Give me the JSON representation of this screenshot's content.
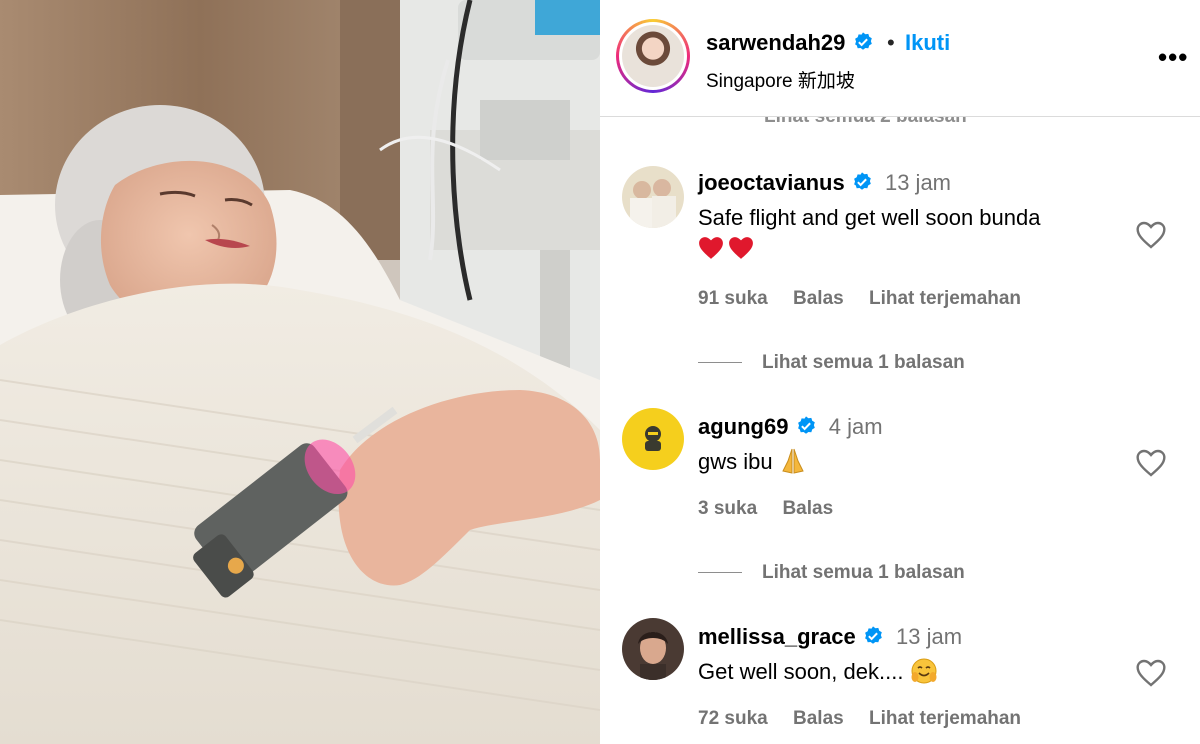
{
  "post": {
    "username": "sarwendah29",
    "follow_label": "Ikuti",
    "separator": "•",
    "location": "Singapore 新加坡",
    "more_label": "•••"
  },
  "comments_partial": {
    "view_replies_label": "Lihat semua 2 balasan"
  },
  "comments": [
    {
      "username": "joeoctavianus",
      "time": "13 jam",
      "text": "Safe flight and get well soon bunda",
      "likes": "91 suka",
      "reply_label": "Balas",
      "translate_label": "Lihat terjemahan",
      "view_replies_label": "Lihat semua 1 balasan"
    },
    {
      "username": "agung69",
      "time": "4 jam",
      "text": "gws ibu",
      "likes": "3 suka",
      "reply_label": "Balas",
      "view_replies_label": "Lihat semua 1 balasan"
    },
    {
      "username": "mellissa_grace",
      "time": "13 jam",
      "text": "Get well soon, dek....",
      "likes": "72 suka",
      "reply_label": "Balas",
      "translate_label": "Lihat terjemahan"
    }
  ],
  "colors": {
    "accent": "#0095f6",
    "muted": "#737373",
    "verified": "#0095f6",
    "heart": "#e0182d"
  },
  "icons": [
    "verified-badge-icon",
    "heart-outline-icon",
    "more-options-icon",
    "red-heart-emoji",
    "praying-hands-emoji",
    "smiling-face-emoji"
  ]
}
